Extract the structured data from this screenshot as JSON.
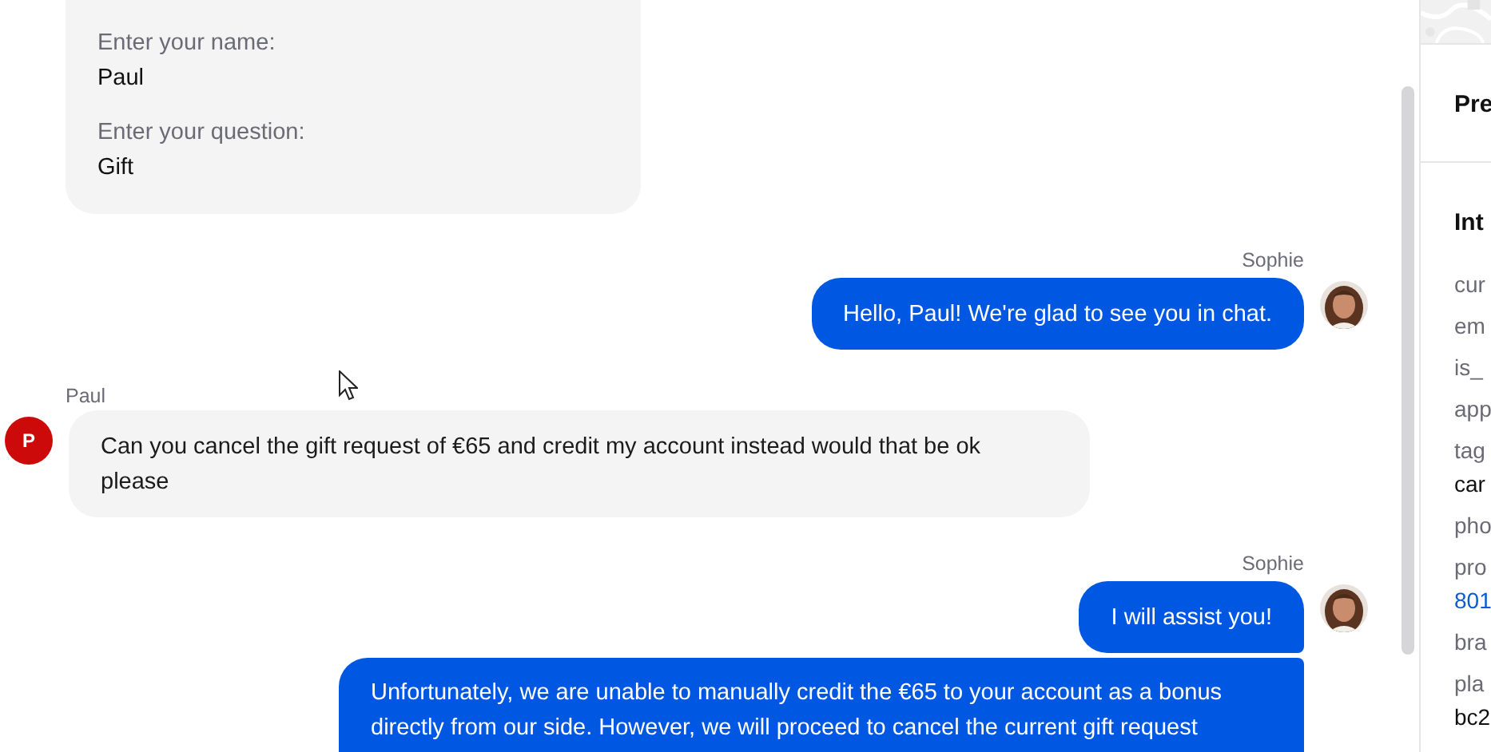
{
  "form_card": {
    "fields": [
      {
        "label": "Enter your name:",
        "value": "Paul"
      },
      {
        "label": "Enter your question:",
        "value": "Gift"
      }
    ]
  },
  "messages": [
    {
      "sender": "Sophie",
      "kind": "agent",
      "bubbles": [
        "Hello, Paul! We're glad to see you in chat."
      ]
    },
    {
      "sender": "Paul",
      "kind": "visitor",
      "avatar_letter": "P",
      "bubbles": [
        "Can you cancel the gift request of €65 and credit my account instead would that be ok please"
      ]
    },
    {
      "sender": "Sophie",
      "kind": "agent",
      "bubbles": [
        "I will assist you!",
        "Unfortunately, we are unable to manually credit the €65 to your account as a bonus directly from our side. However, we will proceed to cancel the current gift request"
      ]
    }
  ],
  "side_panel": {
    "sections": [
      {
        "title": "Pre"
      },
      {
        "title": "Int",
        "rows": [
          {
            "label": "cur"
          },
          {
            "label": "em"
          },
          {
            "label": "is_"
          },
          {
            "label": "app"
          },
          {
            "label": "tag",
            "value": "car",
            "kind": "text"
          },
          {
            "label": "pho"
          },
          {
            "label": "pro",
            "value": "801",
            "kind": "link"
          },
          {
            "label": "bra"
          },
          {
            "label": "pla",
            "value": "bc2",
            "kind": "text"
          }
        ]
      }
    ]
  }
}
